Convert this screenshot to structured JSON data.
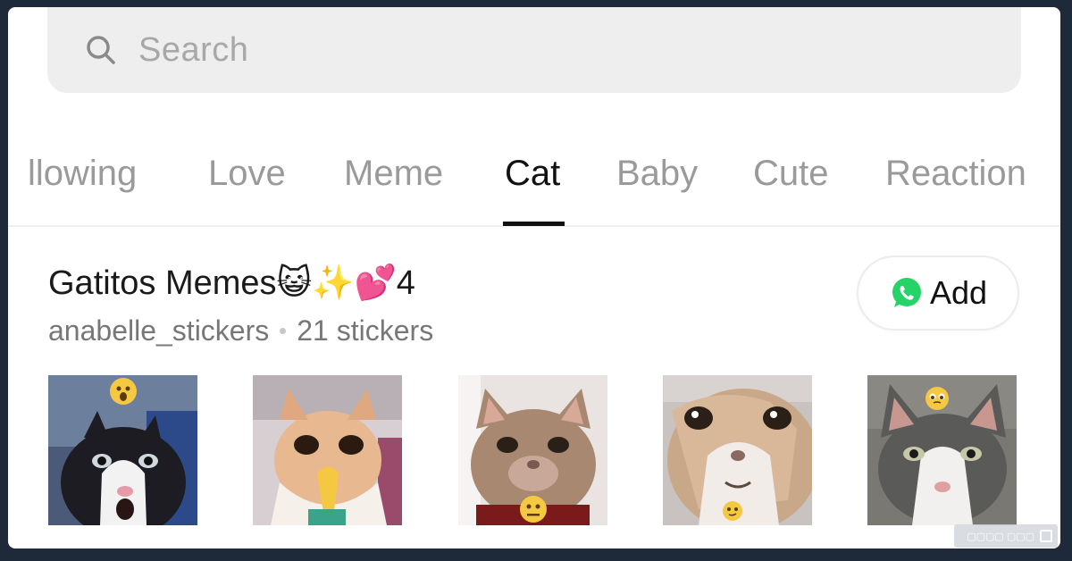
{
  "search": {
    "placeholder": "Search"
  },
  "tabs": [
    {
      "label": "llowing"
    },
    {
      "label": "Love"
    },
    {
      "label": "Meme"
    },
    {
      "label": "Cat",
      "active": true
    },
    {
      "label": "Baby"
    },
    {
      "label": "Cute"
    },
    {
      "label": "Reaction"
    }
  ],
  "pack": {
    "title": "Gatitos Memes😺✨💕4",
    "author": "anabelle_stickers",
    "count": "21 stickers",
    "add_label": "Add",
    "add_icon": "whatsapp-icon"
  },
  "stickers": [
    {
      "name": "black-white-cat-shocked",
      "emoji": "😮"
    },
    {
      "name": "orange-cat-praying",
      "emoji": "🙏"
    },
    {
      "name": "tabby-cat-smiling",
      "emoji": "😐"
    },
    {
      "name": "white-cat-closeup",
      "emoji": "🥴"
    },
    {
      "name": "grey-cat-pleading",
      "emoji": "🥺"
    }
  ],
  "colors": {
    "whatsapp": "#25D366",
    "active_tab": "#111111",
    "inactive_tab": "#9a9a9a"
  }
}
